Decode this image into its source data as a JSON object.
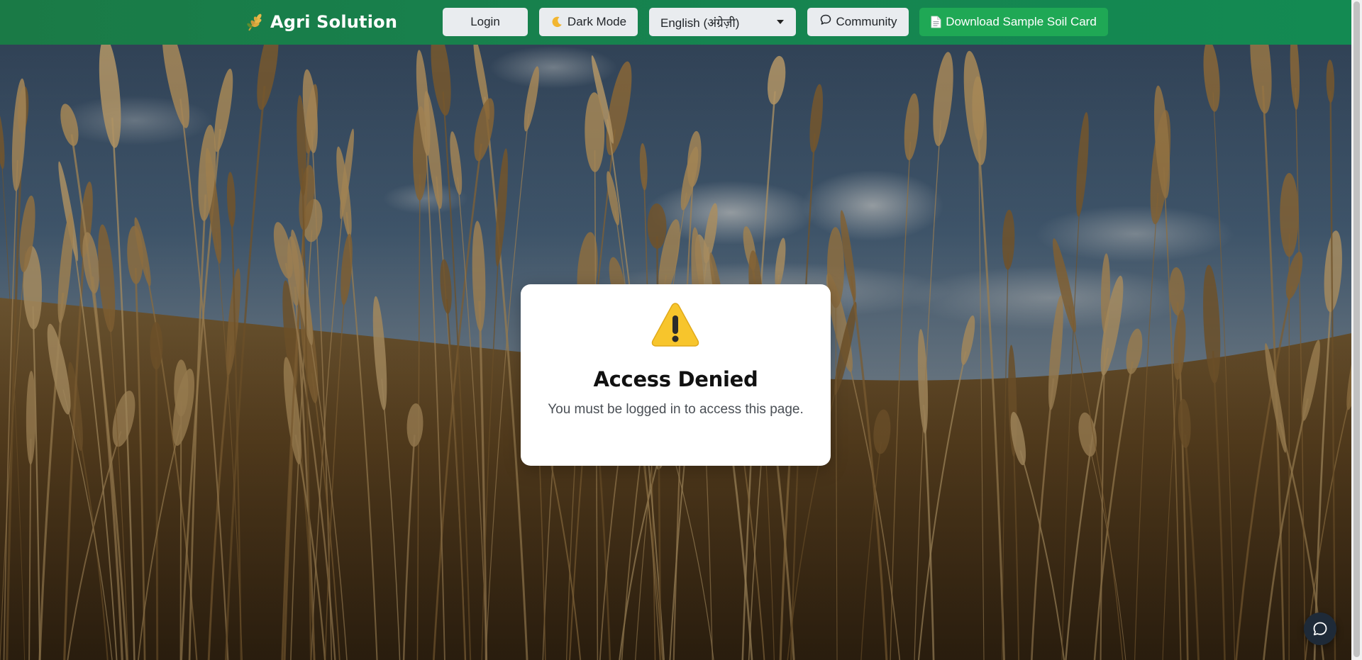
{
  "navbar": {
    "brand": {
      "title": "Agri Solution",
      "icon": "wheat-icon"
    },
    "login_label": "Login",
    "dark_mode_label": "Dark Mode",
    "dark_mode_icon": "moon-icon",
    "language": {
      "selected": "English (अंग्रेज़ी)"
    },
    "community_label": "Community",
    "community_icon": "chat-bubble-icon",
    "download_label": "Download Sample Soil Card",
    "download_icon": "document-icon"
  },
  "access_card": {
    "icon": "warning-icon",
    "title": "Access Denied",
    "message": "You must be logged in to access this page."
  },
  "chat_button": {
    "icon": "chat-bubble-icon"
  },
  "colors": {
    "navbar": "#1a7a46",
    "download_button": "#1fa855",
    "card_background": "#ffffff",
    "chat_button": "#1e2a38"
  }
}
